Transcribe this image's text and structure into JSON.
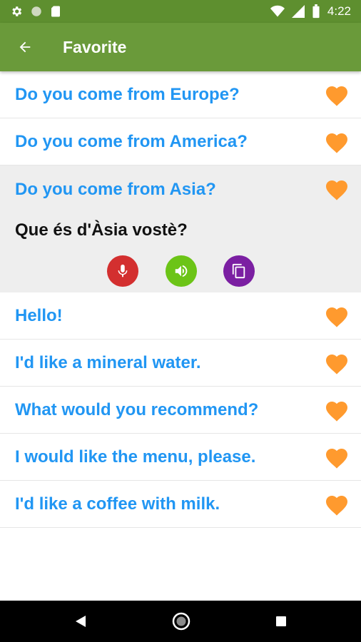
{
  "status_bar": {
    "time": "4:22",
    "icons": [
      "settings-icon",
      "circle-icon",
      "sd-card-icon",
      "wifi-icon",
      "signal-icon",
      "battery-icon"
    ]
  },
  "app_bar": {
    "title": "Favorite",
    "back_icon": "arrow-left-icon",
    "color": "#6a9a3a"
  },
  "phrases": [
    {
      "text": "Do you come from Europe?"
    },
    {
      "text": "Do you come from America?"
    },
    {
      "text": "Do you come from Asia?",
      "translation": "Que és d'Àsia vostè?"
    },
    {
      "text": "Hello!"
    },
    {
      "text": "I'd like a mineral water."
    },
    {
      "text": "What would you recommend?"
    },
    {
      "text": "I would like the menu, please."
    },
    {
      "text": "I'd like a coffee with milk."
    }
  ],
  "colors": {
    "phrase": "#2196f3",
    "heart": "#ff9a2e",
    "mic": "#d32f2f",
    "sound": "#6cc417",
    "copy": "#7b1fa2"
  },
  "actions": [
    "microphone-icon",
    "speaker-icon",
    "copy-icon"
  ],
  "nav_bar": [
    "back-triangle-icon",
    "home-circle-icon",
    "recents-square-icon"
  ]
}
